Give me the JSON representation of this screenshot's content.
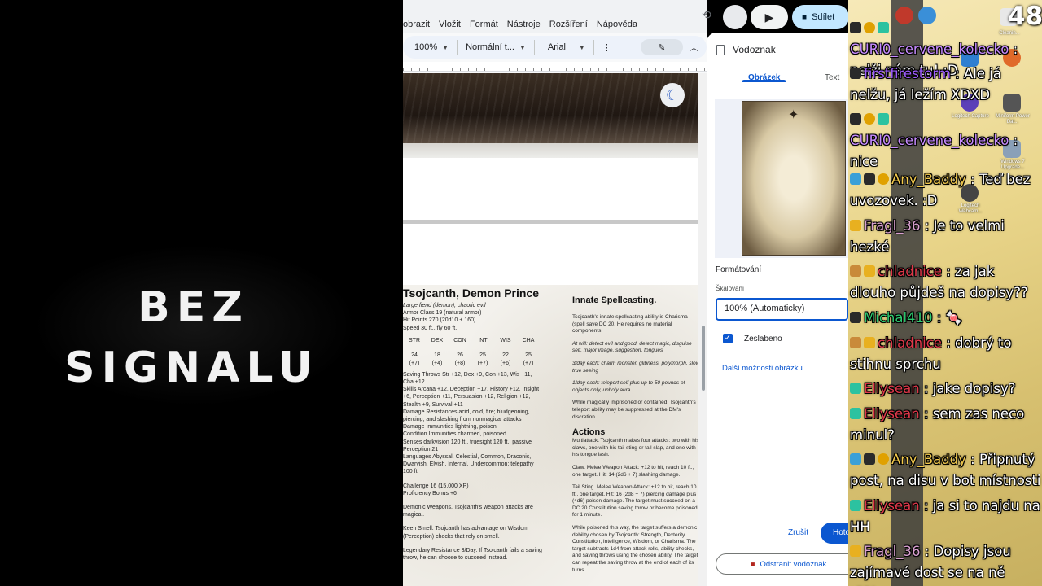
{
  "overlay": {
    "no_signal_line1": "BEZ",
    "no_signal_line2": "SIGNALU",
    "viewer_count": "48"
  },
  "docs": {
    "menu": [
      "obrazit",
      "Vložit",
      "Formát",
      "Nástroje",
      "Rozšíření",
      "Nápověda"
    ],
    "toolbar": {
      "zoom": "100%",
      "style": "Normální t...",
      "font": "Arial",
      "more": "⋮"
    },
    "share_label": "Sdílet",
    "document": {
      "title": "Tsojcanth, Demon Prince",
      "subtitle": "Large fiend (demon), chaotic evil",
      "armor_class": "Armor Class 19 (natural armor)",
      "hit_points": "Hit Points 270 (20d10 + 160)",
      "speed": "Speed 30 ft., fly 60 ft.",
      "stat_headers": [
        "STR",
        "DEX",
        "CON",
        "INT",
        "WIS",
        "CHA"
      ],
      "stat_values": [
        "24",
        "18",
        "26",
        "25",
        "22",
        "25"
      ],
      "stat_mods": [
        "(+7)",
        "(+4)",
        "(+8)",
        "(+7)",
        "(+6)",
        "(+7)"
      ],
      "saving_throws": "Saving Throws Str +12, Dex +9, Con +13, Wis +11, Cha +12",
      "skills": "Skills Arcana +12, Deception +17, History +12, Insight +6, Perception +11, Persuasion +12, Religion +12, Stealth +9, Survival +11",
      "damage_resistances": "Damage Resistances acid, cold, fire; bludgeoning, piercing, and slashing from nonmagical attacks",
      "damage_immunities": "Damage Immunities lightning, poison",
      "condition_immunities": "Condition Immunities charmed, poisoned",
      "senses": "Senses darkvision 120 ft., truesight 120 ft., passive Perception 21",
      "languages": "Languages Abyssal, Celestial, Common, Draconic, Dwarvish, Elvish, Infernal, Undercommon; telepathy 100 ft.",
      "challenge": "Challenge 16 (15,000 XP)",
      "proficiency": "Proficiency Bonus +6",
      "demonic_weapons": "Demonic Weapons. Tsojcanth's weapon attacks are magical.",
      "keen_smell": "Keen Smell. Tsojcanth has advantage on Wisdom (Perception) checks that rely on smell.",
      "legendary_resistance": "Legendary Resistance 3/Day. If Tsojcanth fails a saving throw, he can choose to succeed instead.",
      "col2_heading": "Innate Spellcasting.",
      "spell_intro": "Tsojcanth's innate spellcasting ability is Charisma (spell save DC 20. He requires no material components:",
      "at_will": "At will: detect evil and good, detect magic, disguise self, major image, suggestion, tongues",
      "three_day": "3/day each: charm monster, glibness, polymorph, slow, true seeing",
      "one_day": "1/day each: teleport self plus up to 50 pounds of objects only, unholy aura",
      "magic_note": "While magically imprisoned or contained, Tsojcanth's teleport ability may be suppressed at the DM's discretion.",
      "actions_heading": "Actions",
      "multiattack": "Multiattack. Tsojcanth makes four attacks: two with his claws, one with his tail sting or tail slap, and one with his tongue lash.",
      "claw": "Claw. Melee Weapon Attack: +12 to hit, reach 10 ft., one target. Hit: 14 (2d6 + 7) slashing damage.",
      "tail_sting": "Tail Sting. Melee Weapon Attack: +12 to hit, reach 10 ft., one target. Hit: 16 (2d8 + 7) piercing damage plus 9 (4d6) poison damage. The target must succeed on a DC 20 Constitution saving throw or become poisoned for 1 minute.",
      "poison_note": "While poisoned this way, the target suffers a demonic debility chosen by Tsojcanth: Strength, Dexterity, Constitution, Intelligence, Wisdom, or Charisma. The target subtracts 1d4 from attack rolls, ability checks, and saving throws using the chosen ability. The target can repeat the saving throw at the end of each of its turns"
    }
  },
  "watermark_panel": {
    "title": "Vodoznak",
    "tabs": [
      "Obrázek",
      "Text"
    ],
    "section_title": "Formátování",
    "scale_label": "Škálování",
    "scale_value": "100% (Automaticky)",
    "faded_label": "Zeslabeno",
    "faded_checked": true,
    "more_options": "Další možnosti obrázku",
    "cancel": "Zrušit",
    "done": "Hotovo",
    "remove": "Odstranit vodoznak"
  },
  "desktop_icons": [
    {
      "label": "Cleanin..."
    },
    {
      "label": "Logitech Capture"
    },
    {
      "label": "Miniform Power Dat..."
    },
    {
      "label": "Windows 7 Upgrade..."
    },
    {
      "label": "Logitech Webcam..."
    }
  ],
  "chat": [
    {
      "user": "CURI0_cervene_kolecko",
      "color": "#c78bff",
      "badges": [
        "mod",
        "one",
        "sub"
      ],
      "text": "nelži nám tu! :D"
    },
    {
      "user": "firstfirestorm",
      "color": "#9f5cff",
      "badges": [
        "mod"
      ],
      "text": "Ale já nelžu, já ležím XDXD"
    },
    {
      "user": "CURI0_cervene_kolecko",
      "color": "#c78bff",
      "badges": [
        "mod",
        "one",
        "sub"
      ],
      "text": "nice"
    },
    {
      "user": "Any_Baddy",
      "color": "#f2c94c",
      "badges": [
        "vip",
        "mod",
        "one"
      ],
      "text": "Teď bez uvozovek. :D"
    },
    {
      "user": "Fragl_36",
      "color": "#d9a0d0",
      "badges": [
        "prime"
      ],
      "text": "Je to velmi hezké"
    },
    {
      "user": "chladnice",
      "color": "#e0384a",
      "badges": [
        "gift",
        "prime"
      ],
      "text": "za jak dlouho půjdeš na dopisy??"
    },
    {
      "user": "Michal410",
      "color": "#2ecc71",
      "badges": [
        "mod"
      ],
      "text": "🍬"
    },
    {
      "user": "chladnice",
      "color": "#e0384a",
      "badges": [
        "gift",
        "prime"
      ],
      "text": "dobrý to stihnu sprchu"
    },
    {
      "user": "Ellysean",
      "color": "#e0384a",
      "badges": [
        "sub"
      ],
      "text": "jake dopisy?"
    },
    {
      "user": "Ellysean",
      "color": "#e0384a",
      "badges": [
        "sub"
      ],
      "text": "sem zas neco minul?"
    },
    {
      "user": "Any_Baddy",
      "color": "#f2c94c",
      "badges": [
        "vip",
        "mod",
        "one"
      ],
      "text": "Připnutý post, na disu v bot místnosti"
    },
    {
      "user": "Ellysean",
      "color": "#e0384a",
      "badges": [
        "sub"
      ],
      "text": "ja si to najdu na HH"
    },
    {
      "user": "Fragl_36",
      "color": "#d9a0d0",
      "badges": [
        "prime"
      ],
      "text": "Dopisy jsou zajímavé dost se na ně těším"
    }
  ]
}
